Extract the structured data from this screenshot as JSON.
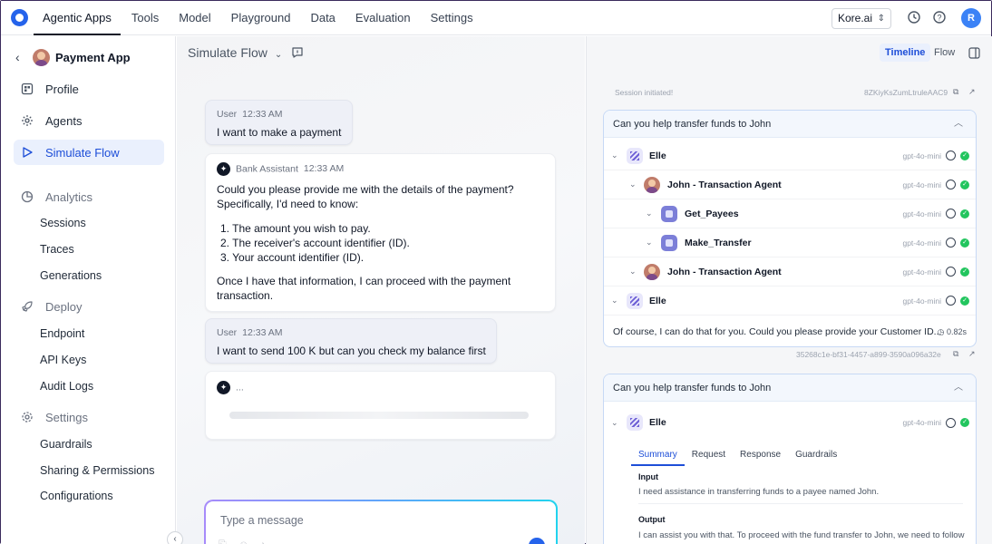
{
  "nav": {
    "items": [
      "Agentic Apps",
      "Tools",
      "Model",
      "Playground",
      "Data",
      "Evaluation",
      "Settings"
    ],
    "active": "Agentic Apps",
    "org": "Kore.ai",
    "avatar_initial": "R"
  },
  "sidebar": {
    "app_name": "Payment App",
    "items": [
      {
        "label": "Profile",
        "icon": "profile-icon"
      },
      {
        "label": "Agents",
        "icon": "agents-icon"
      },
      {
        "label": "Simulate Flow",
        "icon": "play-icon",
        "active": true
      }
    ],
    "sections": [
      {
        "label": "Analytics",
        "icon": "analytics-icon",
        "subitems": [
          "Sessions",
          "Traces",
          "Generations"
        ]
      },
      {
        "label": "Deploy",
        "icon": "rocket-icon",
        "subitems": [
          "Endpoint",
          "API Keys",
          "Audit Logs"
        ]
      },
      {
        "label": "Settings",
        "icon": "gear-icon",
        "subitems": [
          "Guardrails",
          "Sharing & Permissions",
          "Configurations"
        ]
      }
    ]
  },
  "chat": {
    "title": "Simulate Flow",
    "messages": [
      {
        "role": "User",
        "time": "12:33 AM",
        "text": "I want to make a payment"
      },
      {
        "role": "Bank Assistant",
        "time": "12:33 AM",
        "intro": "Could you please provide me with the details of the payment? Specifically, I'd need to know:",
        "list": [
          "The amount you wish to pay.",
          "The receiver's account identifier (ID).",
          "Your account identifier (ID)."
        ],
        "outro": "Once I have that information, I can proceed with the payment transaction."
      },
      {
        "role": "User",
        "time": "12:33 AM",
        "text": "I want to send 100 K but can you check my balance first"
      },
      {
        "role": "assistant-typing",
        "text": "..."
      }
    ],
    "input_placeholder": "Type a message"
  },
  "trace": {
    "view_tabs": [
      "Timeline",
      "Flow"
    ],
    "active_view": "Timeline",
    "session_label": "Session initiated!",
    "session_id": "8ZKiyKsZumLtruleAAC9",
    "card1": {
      "title": "Can you help transfer funds to John",
      "rows": [
        {
          "label": "Elle",
          "model": "gpt-4o-mini",
          "kind": "elle"
        },
        {
          "label": "John - Transaction Agent",
          "model": "gpt-4o-mini",
          "kind": "john"
        },
        {
          "label": "Get_Payees",
          "model": "gpt-4o-mini",
          "kind": "tool"
        },
        {
          "label": "Make_Transfer",
          "model": "gpt-4o-mini",
          "kind": "tool"
        },
        {
          "label": "John - Transaction Agent",
          "model": "gpt-4o-mini",
          "kind": "john"
        },
        {
          "label": "Elle",
          "model": "gpt-4o-mini",
          "kind": "elle"
        }
      ],
      "response": "Of course, I can do that for you. Could you please provide your Customer ID...",
      "duration": "0.82s"
    },
    "trace_id": "35268c1e-bf31-4457-a899-3590a096a32e",
    "card2": {
      "title": "Can you help transfer funds to John",
      "row": {
        "label": "Elle",
        "model": "gpt-4o-mini"
      },
      "tabs": [
        "Summary",
        "Request",
        "Response",
        "Guardrails"
      ],
      "active_tab": "Summary",
      "input_label": "Input",
      "input_text": "I need assistance in transferring funds to a payee named John.",
      "output_label": "Output",
      "output_text": "I can assist you with that. To proceed with the fund transfer to John, we need to follow these steps:"
    }
  }
}
